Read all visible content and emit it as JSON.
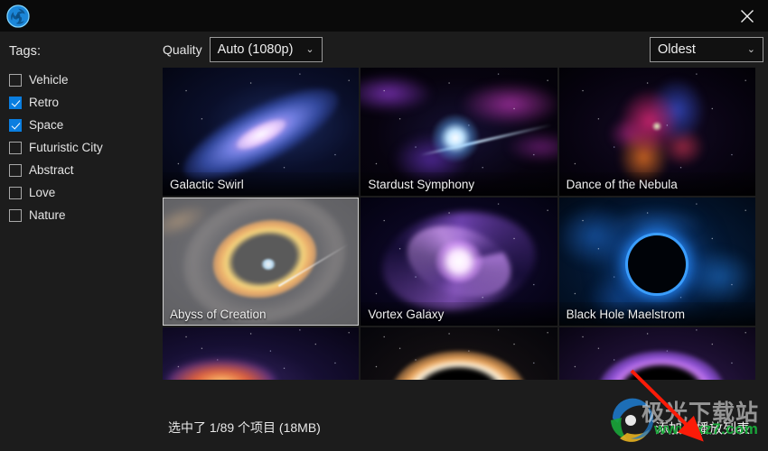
{
  "window": {
    "logo_icon": "app-logo-icon",
    "close_label": "✕"
  },
  "sidebar": {
    "title": "Tags:",
    "items": [
      {
        "label": "Vehicle",
        "checked": false
      },
      {
        "label": "Retro",
        "checked": true
      },
      {
        "label": "Space",
        "checked": true
      },
      {
        "label": "Futuristic City",
        "checked": false
      },
      {
        "label": "Abstract",
        "checked": false
      },
      {
        "label": "Love",
        "checked": false
      },
      {
        "label": "Nature",
        "checked": false
      }
    ]
  },
  "toolbar": {
    "quality_label": "Quality",
    "quality_value": "Auto (1080p)",
    "quality_options": [
      "Auto (1080p)"
    ],
    "sort_value": "Oldest",
    "sort_options": [
      "Oldest"
    ],
    "chevron": "⌄"
  },
  "grid": {
    "items": [
      {
        "title": "Galactic Swirl",
        "selected": false,
        "art": "art-swirl"
      },
      {
        "title": "Stardust Symphony",
        "selected": false,
        "art": "art-stardust"
      },
      {
        "title": "Dance of the Nebula",
        "selected": false,
        "art": "art-nebula"
      },
      {
        "title": "Abyss of Creation",
        "selected": true,
        "art": "art-abyss"
      },
      {
        "title": "Vortex Galaxy",
        "selected": false,
        "art": "art-vortex"
      },
      {
        "title": "Black Hole Maelstrom",
        "selected": false,
        "art": "art-maelstrom"
      }
    ]
  },
  "footer": {
    "status": "选中了 1/89 个项目 (18MB)",
    "playlist_button": "添加到播放列表"
  },
  "watermark": {
    "site_name": "极光下载站",
    "url": "www.xz7.com"
  },
  "colors": {
    "accent": "#0a7ee0",
    "window_bg": "#1c1c1c",
    "titlebar_bg": "#0a0a0a",
    "text": "#e8e8e8",
    "arrow": "#fb1b08",
    "watermark_green": "#1aa63a"
  }
}
